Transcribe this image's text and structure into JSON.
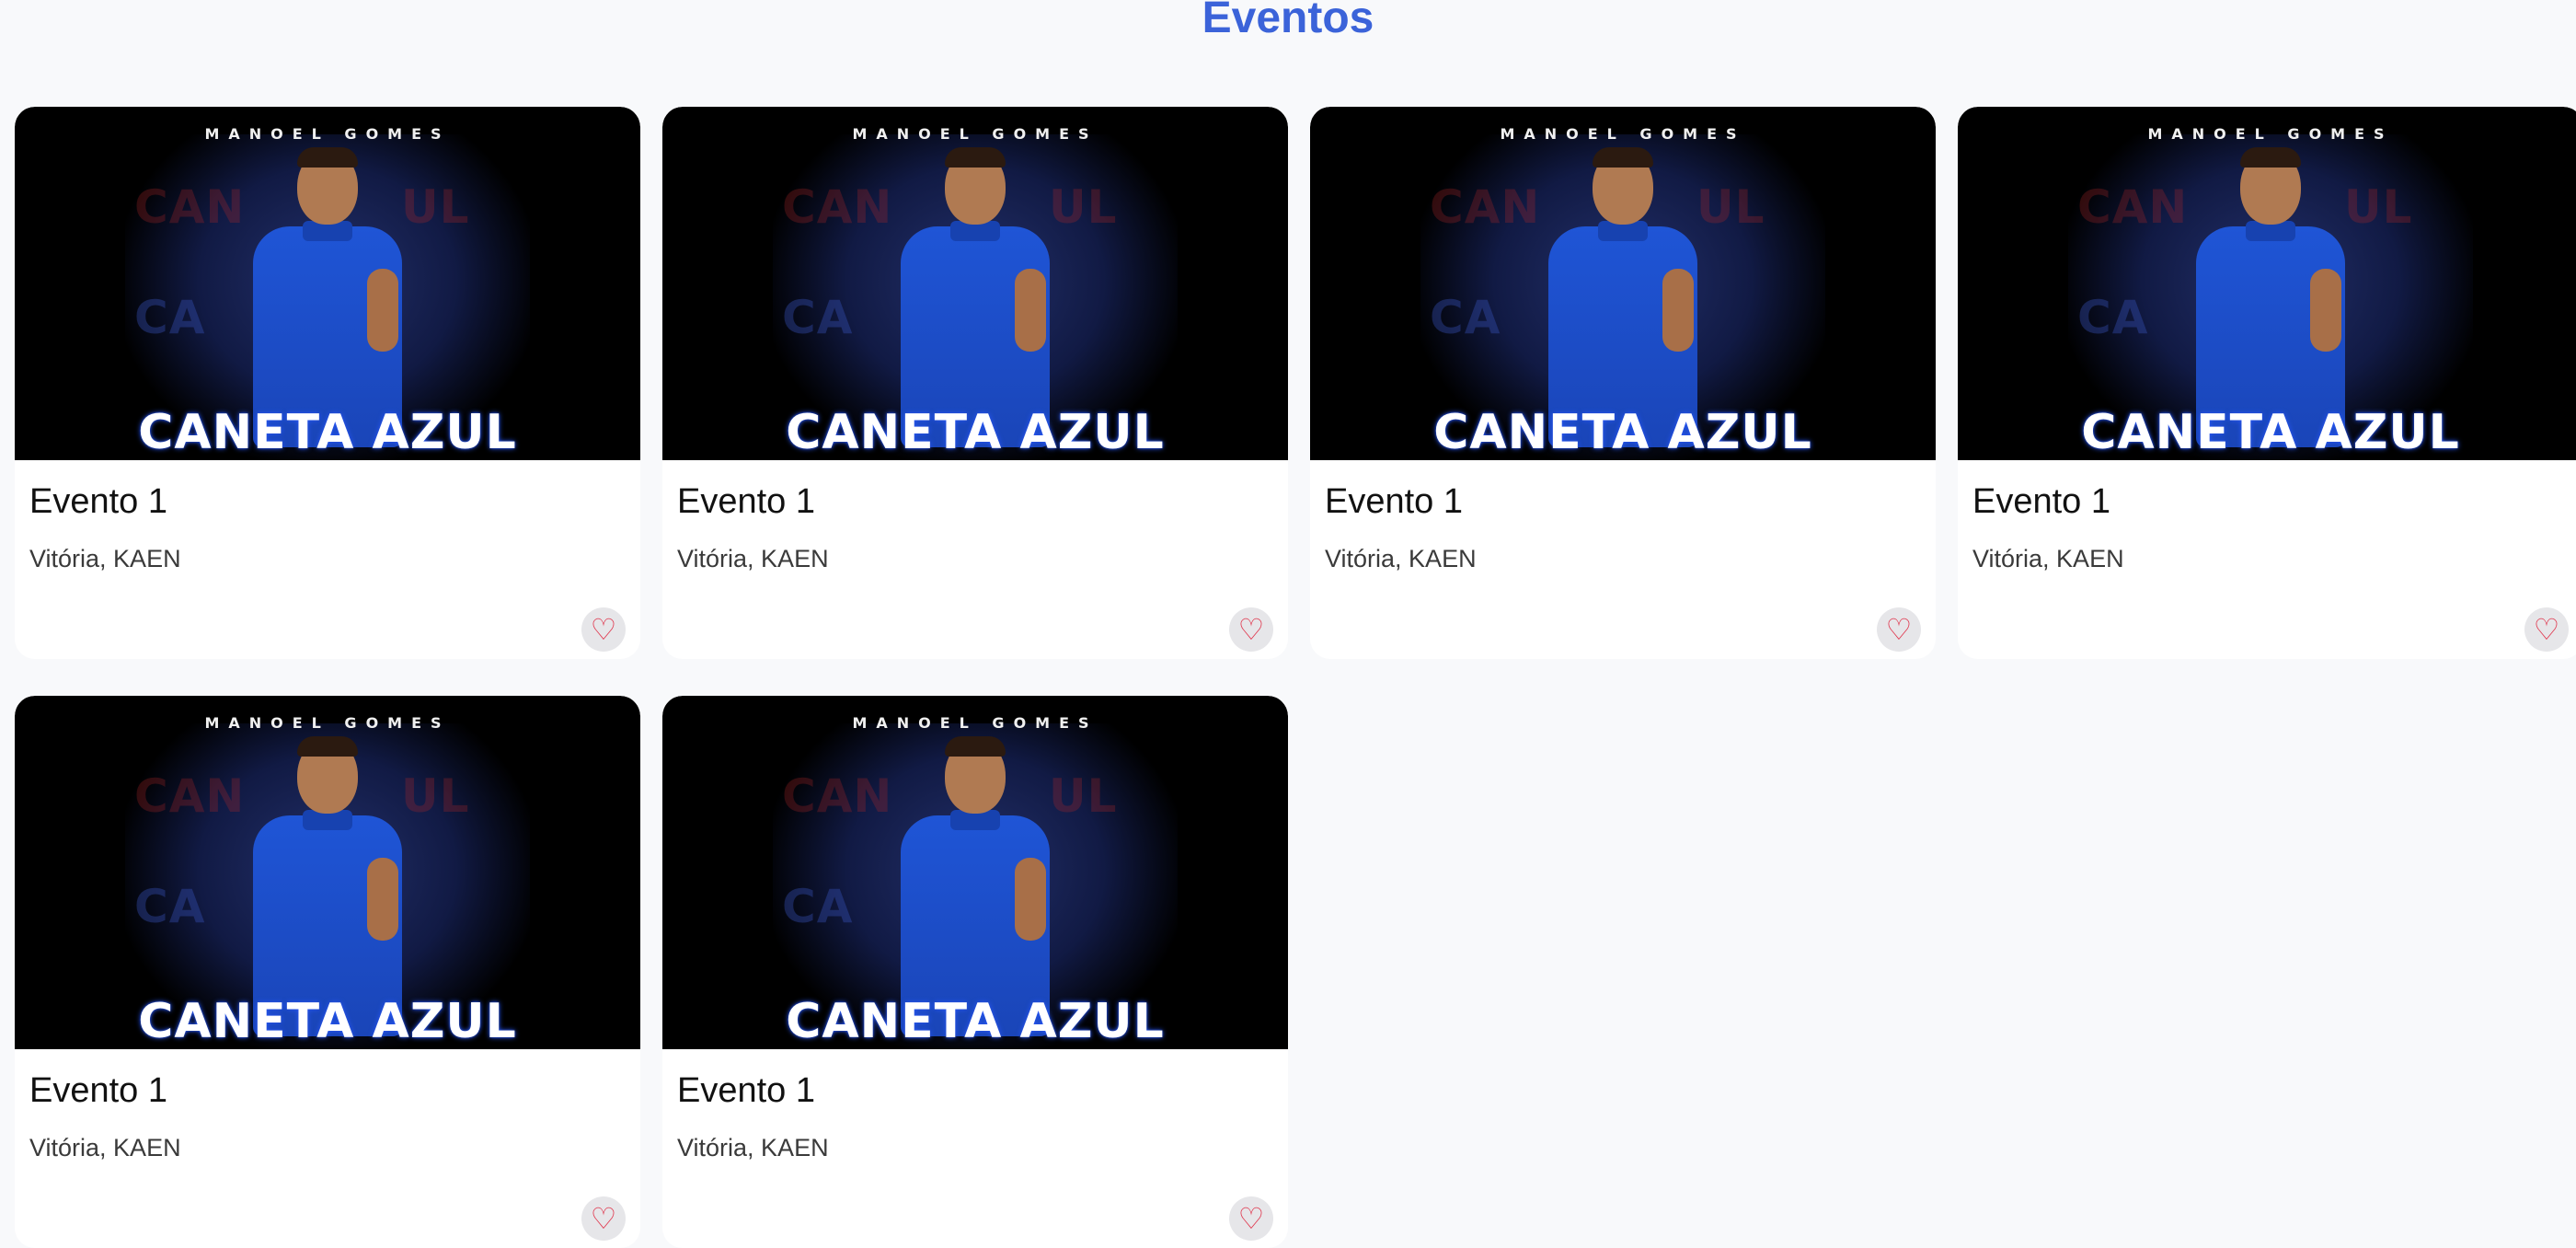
{
  "page": {
    "title": "Eventos"
  },
  "events": [
    {
      "title": "Evento 1",
      "location": "Vitória, KAEN",
      "image_artist": "MANOEL GOMES",
      "image_title": "CANETA AZUL",
      "favorite_icon": "heart-outline"
    },
    {
      "title": "Evento 1",
      "location": "Vitória, KAEN",
      "image_artist": "MANOEL GOMES",
      "image_title": "CANETA AZUL",
      "favorite_icon": "heart-outline"
    },
    {
      "title": "Evento 1",
      "location": "Vitória, KAEN",
      "image_artist": "MANOEL GOMES",
      "image_title": "CANETA AZUL",
      "favorite_icon": "heart-outline"
    },
    {
      "title": "Evento 1",
      "location": "Vitória, KAEN",
      "image_artist": "MANOEL GOMES",
      "image_title": "CANETA AZUL",
      "favorite_icon": "heart-outline"
    },
    {
      "title": "Evento 1",
      "location": "Vitória, KAEN",
      "image_artist": "MANOEL GOMES",
      "image_title": "CANETA AZUL",
      "favorite_icon": "heart-outline"
    },
    {
      "title": "Evento 1",
      "location": "Vitória, KAEN",
      "image_artist": "MANOEL GOMES",
      "image_title": "CANETA AZUL",
      "favorite_icon": "heart-outline"
    }
  ],
  "colors": {
    "accent": "#3b63d9",
    "heart": "#e0344b",
    "background": "#f8f9fb"
  }
}
